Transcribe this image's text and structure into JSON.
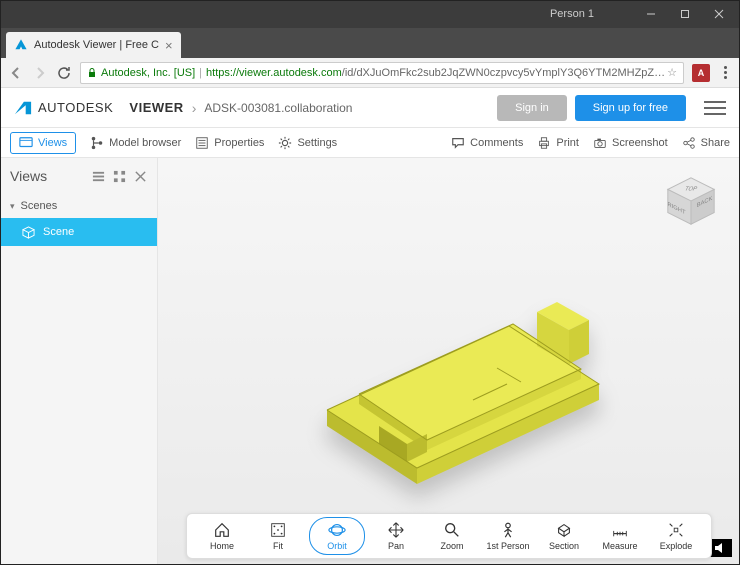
{
  "browser": {
    "persona": "Person 1",
    "tab_title": "Autodesk Viewer | Free C",
    "url_org": "Autodesk, Inc. [US]",
    "url_scheme": "https://",
    "url_host": "viewer.autodesk.com",
    "url_path": "/id/dXJuOmFkc2sub2JqZWN0czpvcy5vYmplY3Q6YTM2MHZpZXdlci90NjM2NTY1MjM1OTMz...",
    "extension_label": "A"
  },
  "header": {
    "brand_prefix": "AUTODESK",
    "brand_suffix": "VIEWER",
    "breadcrumb": "ADSK-003081.collaboration",
    "sign_in": "Sign in",
    "sign_up": "Sign up for free"
  },
  "toolbar": {
    "views": "Views",
    "model_browser": "Model browser",
    "properties": "Properties",
    "settings": "Settings",
    "comments": "Comments",
    "print": "Print",
    "screenshot": "Screenshot",
    "share": "Share"
  },
  "sidebar": {
    "title": "Views",
    "section": "Scenes",
    "item": "Scene"
  },
  "viewcube": {
    "top": "TOP",
    "right": "RIGHT",
    "back": "BACK"
  },
  "bottom": {
    "home": "Home",
    "fit": "Fit",
    "orbit": "Orbit",
    "pan": "Pan",
    "zoom": "Zoom",
    "first_person": "1st Person",
    "section": "Section",
    "measure": "Measure",
    "explode": "Explode"
  }
}
